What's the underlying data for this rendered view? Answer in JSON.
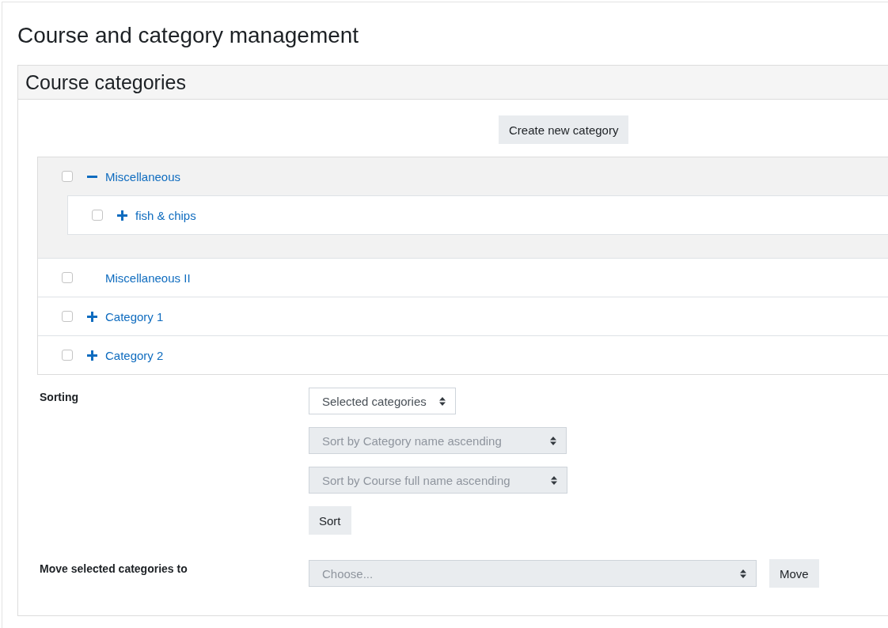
{
  "page": {
    "title": "Course and category management"
  },
  "panel": {
    "title": "Course categories",
    "create_button": "Create new category",
    "categories": [
      {
        "name": "Miscellaneous",
        "checked": false,
        "expandable": true,
        "expanded": true,
        "children": [
          {
            "name": "fish & chips",
            "checked": false,
            "expandable": true,
            "expanded": false
          }
        ]
      },
      {
        "name": "Miscellaneous II",
        "checked": false,
        "expandable": false,
        "expanded": false
      },
      {
        "name": "Category 1",
        "checked": false,
        "expandable": true,
        "expanded": false
      },
      {
        "name": "Category 2",
        "checked": false,
        "expandable": true,
        "expanded": false
      }
    ]
  },
  "sorting": {
    "label": "Sorting",
    "selects": [
      {
        "value": "Selected categories",
        "disabled": false
      },
      {
        "value": "Sort by Category name ascending",
        "disabled": true
      },
      {
        "value": "Sort by Course full name ascending",
        "disabled": true
      }
    ],
    "button": "Sort"
  },
  "move": {
    "label": "Move selected categories to",
    "select": {
      "value": "Choose...",
      "disabled": true
    },
    "button": "Move"
  }
}
